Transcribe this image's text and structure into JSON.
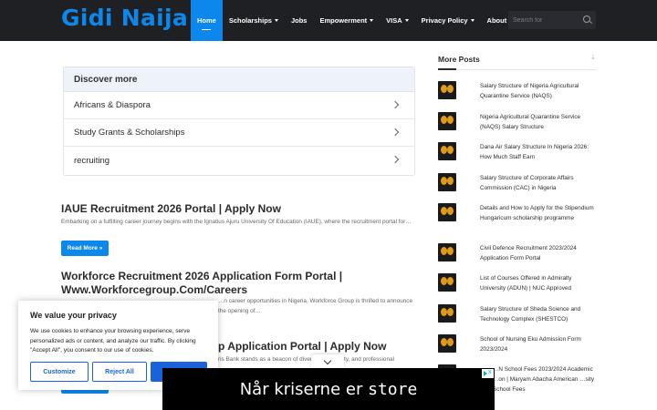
{
  "site": {
    "logo": "Gidi Naija"
  },
  "nav": {
    "items": [
      {
        "label": "Home",
        "caret": false
      },
      {
        "label": "Scholarships",
        "caret": true
      },
      {
        "label": "Jobs",
        "caret": false
      },
      {
        "label": "Empowerment",
        "caret": true
      },
      {
        "label": "VISA",
        "caret": true
      },
      {
        "label": "Privacy Policy",
        "caret": true
      },
      {
        "label": "About Us",
        "caret": true
      }
    ],
    "search_placeholder": "Search for"
  },
  "discover": {
    "title": "Discover more",
    "items": [
      "Africans & Diaspora",
      "Study Grants & Scholarships",
      "recruiting"
    ]
  },
  "posts": [
    {
      "title": "IAUE Recruitment 2026 Portal | Apply Now",
      "excerpt": "Embarking on a fulfilling career journey begins with the Ignatius Ajuru University Of Education (IAUE), where the recruitment portal for…",
      "read_more": "Read More »"
    },
    {
      "title_line1": "Workforce Recruitment 2026 Application Form Portal |",
      "title_line2": "Www.Workforcegroup.Com/Careers",
      "excerpt_partial": "…n career opportunities in Nigeria, Workforce Group is thrilled to announce the opening of…"
    },
    {
      "title_partial": "p Application Portal | Apply Now",
      "excerpt_partial": "ris Bank stands as a beacon of diversity, inclusivity, and professional"
    }
  ],
  "sidebar": {
    "title": "More Posts",
    "items": [
      "Salary Structure of Nigeria Agricultural Quarantine Service (NAQS)",
      "Nigeria Agricultural Quarantine Service (NAQS) Salary Structure",
      "Dana Air Salary Structure In Nigeria 2026: How Much Staff Earn",
      "Salary Structure of Corporate Affairs Commission (CAC) in Nigeria",
      "Details and How to Apply for the Stipendium Hungaricum scholarship programme",
      "Civil Defence Recruitment 2023/2024 Application Form Portal",
      "List of Courses Offered in Admiralty University (ADUN) | NUC Approved",
      "Salary Structure of Sheda Science and Technology Complex (SHESTCO)",
      "School of Nursing Eku Admission Form 2023/2024",
      "…N School Fees 2023/2024 Academic …on | Maryam Abacha American …sity School Fees"
    ]
  },
  "cookie": {
    "title": "We value your privacy",
    "body": "We use cookies to enhance your browsing experience, serve personalized ads or content, and analyze our traffic. By clicking \"Accept All\", you consent to our use of cookies.",
    "customize": "Customize",
    "reject": "Reject All",
    "accept": ""
  },
  "ad": {
    "text_word1": "Når kriserne er",
    "text_word2": "store"
  },
  "colors": {
    "accent": "#0c88ec",
    "header_bg": "#1f2024",
    "cookie_accent": "#1863dc"
  }
}
